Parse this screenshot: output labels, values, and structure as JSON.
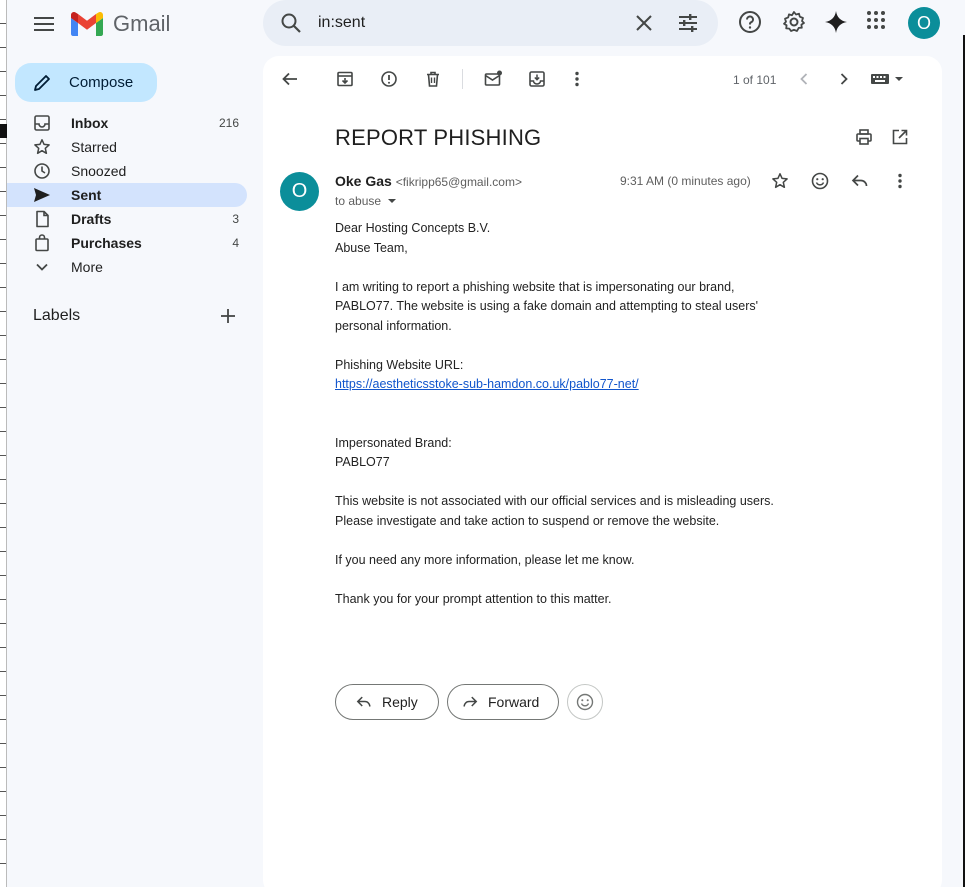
{
  "app": {
    "name": "Gmail"
  },
  "search": {
    "query": "in:sent"
  },
  "user": {
    "initial": "O"
  },
  "compose": {
    "label": "Compose"
  },
  "sidebar": {
    "items": [
      {
        "label": "Inbox",
        "count": "216"
      },
      {
        "label": "Starred",
        "count": ""
      },
      {
        "label": "Snoozed",
        "count": ""
      },
      {
        "label": "Sent",
        "count": ""
      },
      {
        "label": "Drafts",
        "count": "3"
      },
      {
        "label": "Purchases",
        "count": "4"
      },
      {
        "label": "More",
        "count": ""
      }
    ],
    "labels_header": "Labels"
  },
  "toolbar": {
    "pager": "1 of 101"
  },
  "message": {
    "subject": "REPORT PHISHING",
    "sender_name": "Oke Gas",
    "sender_email": "<fikripp65@gmail.com>",
    "to": "to abuse",
    "time": "9:31 AM (0 minutes ago)",
    "avatar_initial": "O",
    "body": {
      "p1_l1": "Dear Hosting Concepts B.V.",
      "p1_l2": "Abuse Team,",
      "p2": "I am writing to report a phishing website that is impersonating our brand, PABLO77. The website is using a fake domain and attempting to steal users' personal information.",
      "p3_label": "Phishing Website URL:",
      "p3_url": "https://aestheticsstoke-sub-hamdon.co.uk/pablo77-net/",
      "p4_label": "Impersonated Brand:",
      "p4_value": "PABLO77",
      "p5": "This website is not associated with our official services and is misleading users. Please investigate and take action to suspend or remove the website.",
      "p6": "If you need any more information, please let me know.",
      "p7": "Thank you for your prompt attention to this matter."
    }
  },
  "actions": {
    "reply": "Reply",
    "forward": "Forward"
  },
  "colors": {
    "accent": "#c2e7ff",
    "active_nav": "#d3e3fd",
    "avatar": "#0b8e9a",
    "link": "#1155cc"
  }
}
